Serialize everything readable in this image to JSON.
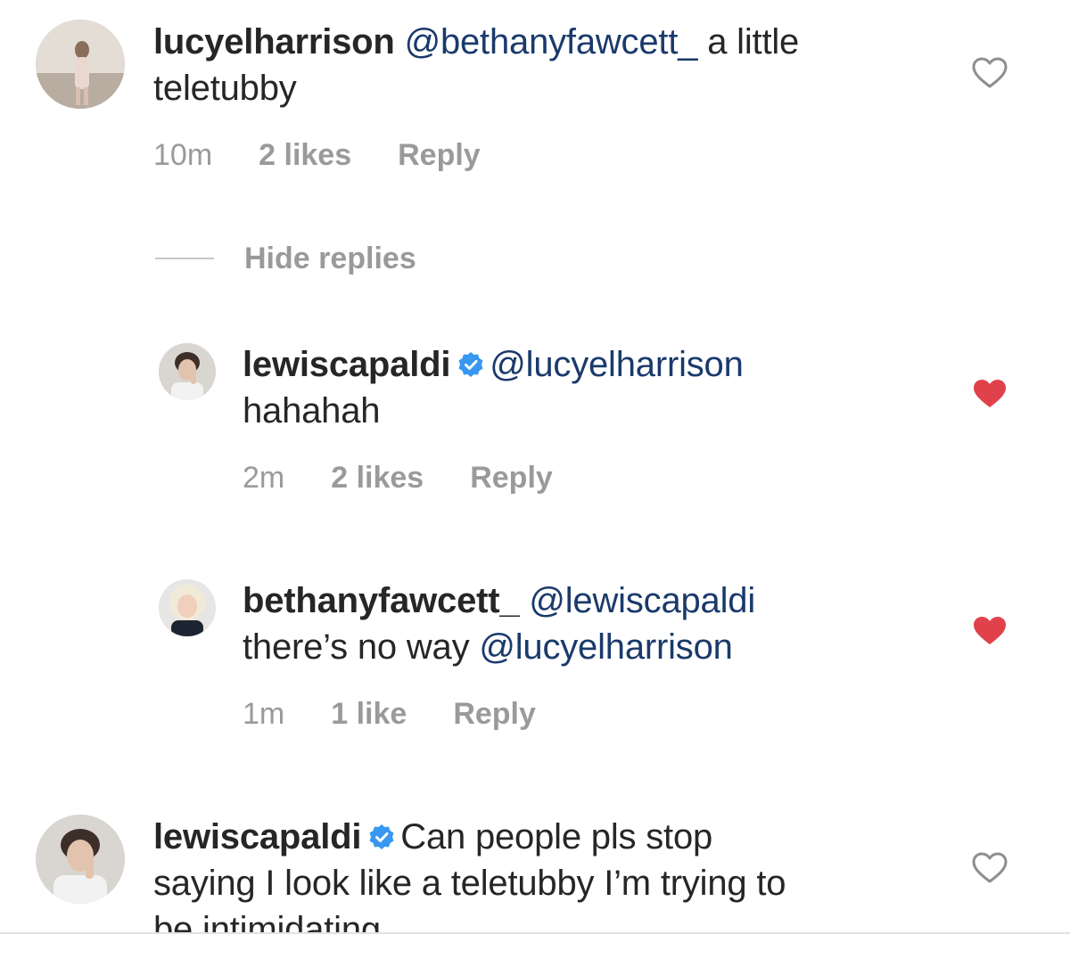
{
  "comments": [
    {
      "username": "lucyelharrison",
      "mention": "@bethanyfawcett_",
      "text_line1": "a little",
      "text_line2": "teletubby",
      "time": "10m",
      "likes": "2 likes",
      "reply": "Reply",
      "liked": false,
      "verified": false
    },
    {
      "username": "lewiscapaldi",
      "mention": "@lucyelharrison",
      "text_line2": "hahahah",
      "time": "2m",
      "likes": "2 likes",
      "reply": "Reply",
      "liked": true,
      "verified": true
    },
    {
      "username": "bethanyfawcett_",
      "mention": "@lewiscapaldi",
      "text_line2_prefix": "there’s no way",
      "text_line2_mention": "@lucyelharrison",
      "time": "1m",
      "likes": "1 like",
      "reply": "Reply",
      "liked": true,
      "verified": false
    },
    {
      "username": "lewiscapaldi",
      "text_line1": "Can people pls stop",
      "text_line2": "saying I look like a teletubby I’m trying to",
      "text_line3": "be intimidating",
      "liked": false,
      "verified": true
    }
  ],
  "hide_replies_label": "Hide replies",
  "icons": {
    "like": "heart-icon",
    "liked": "heart-filled-icon",
    "verified": "verified-badge-icon"
  },
  "colors": {
    "liked_heart": "#e0424b",
    "verified": "#3897f0",
    "mention": "#1a3a6b",
    "meta": "#9a9a9a"
  }
}
